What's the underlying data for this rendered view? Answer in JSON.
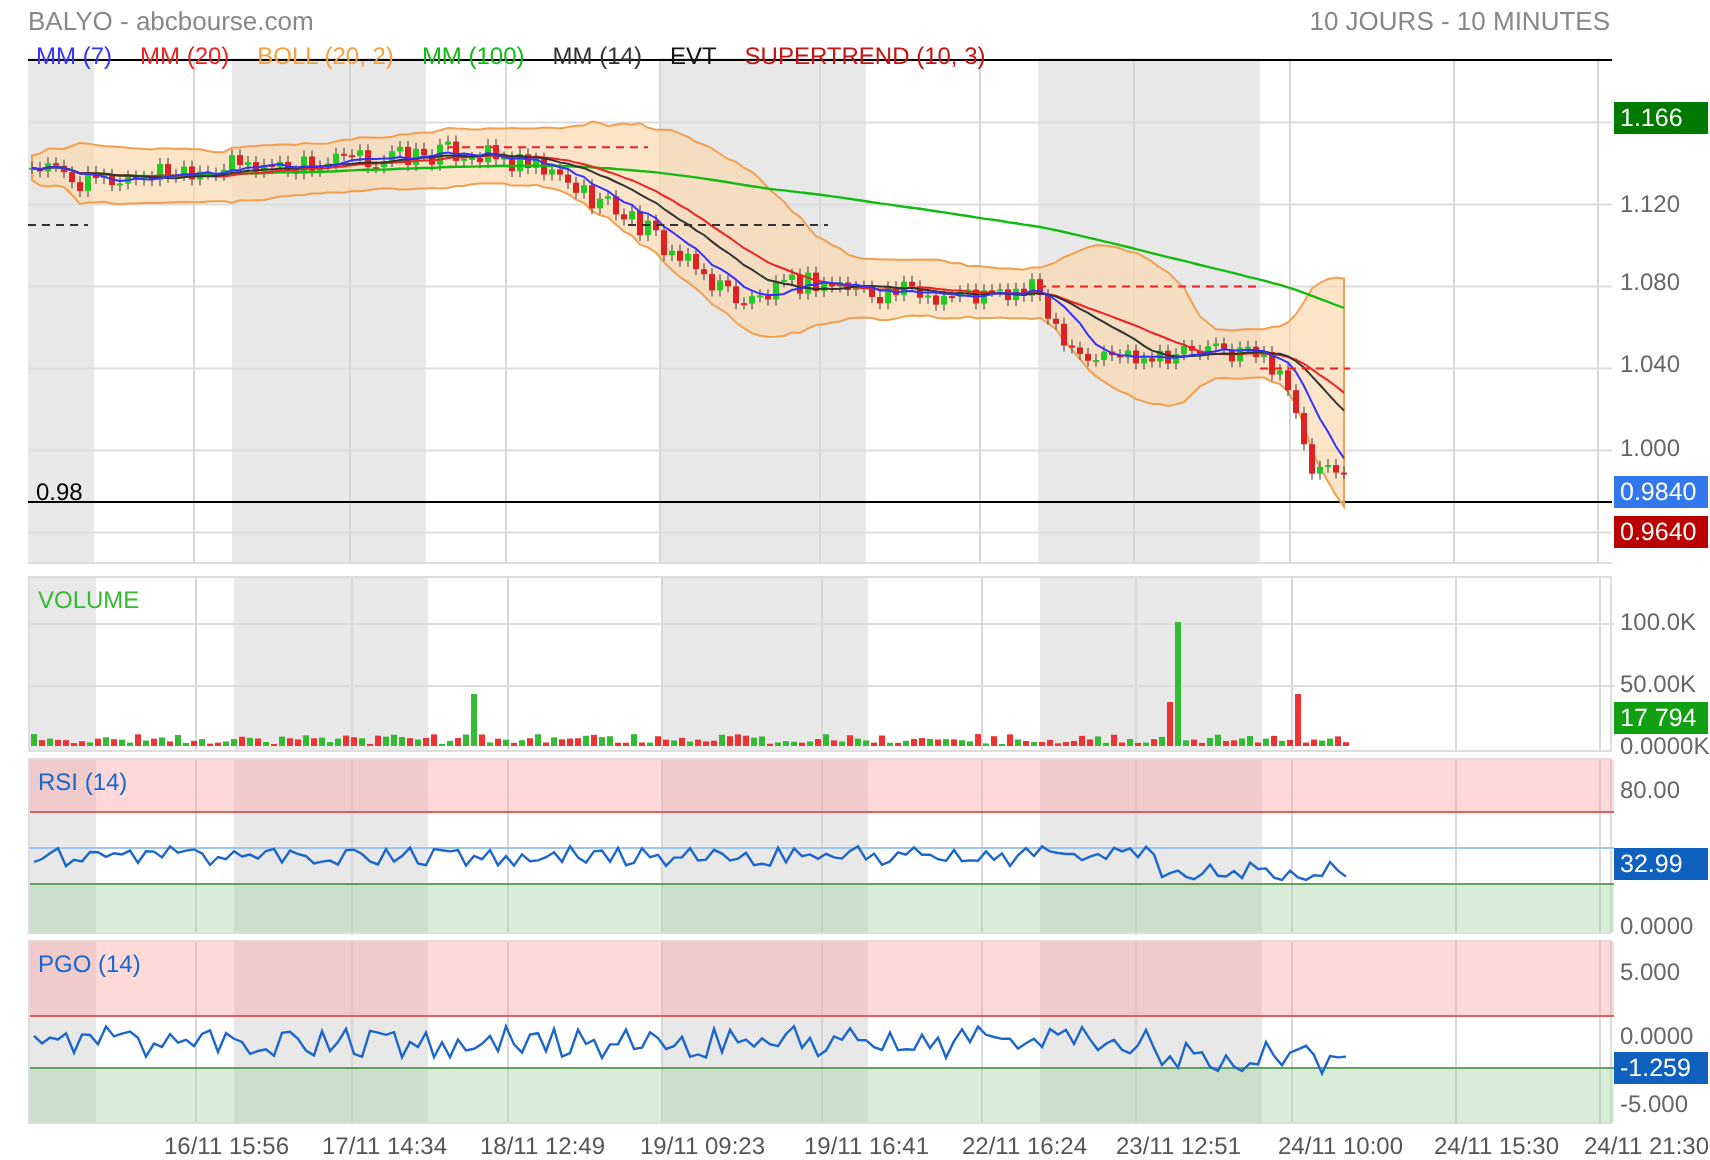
{
  "header": {
    "title": "BALYO - abcbourse.com",
    "period": "10 JOURS - 10 MINUTES"
  },
  "price_panel": {
    "legend": [
      {
        "label": "MM (7)",
        "color": "#3333ff"
      },
      {
        "label": "MM (20)",
        "color": "#ee2222"
      },
      {
        "label": "BOLL (20, 2)",
        "color": "#f5a040"
      },
      {
        "label": "MM (100)",
        "color": "#11bb11"
      },
      {
        "label": "MM (14)",
        "color": "#333333"
      },
      {
        "label": "EVT",
        "color": "#111111"
      },
      {
        "label": "SUPERTREND (10, 3)",
        "color": "#cc1111"
      }
    ],
    "line_label": "0.98",
    "ticks": [
      "1.120",
      "1.080",
      "1.040",
      "1.000"
    ],
    "badges": [
      {
        "text": "1.166",
        "color": "#007a00"
      },
      {
        "text": "0.9840",
        "color": "#3377ee"
      },
      {
        "text": "0.9640",
        "color": "#bb0000"
      }
    ]
  },
  "volume_panel": {
    "title": "VOLUME",
    "ticks": [
      "100.0K",
      "50.00K",
      "0.0000K"
    ],
    "badge": {
      "text": "17 794",
      "color": "#11a011"
    }
  },
  "rsi_panel": {
    "title": "RSI (14)",
    "ticks": [
      "80.00",
      "0.0000"
    ],
    "badge": {
      "text": "32.99",
      "color": "#1060c0"
    }
  },
  "pgo_panel": {
    "title": "PGO (14)",
    "ticks": [
      "5.000",
      "0.0000",
      "-5.000"
    ],
    "badge": {
      "text": "-1.259",
      "color": "#1060c0"
    }
  },
  "x_axis": [
    "16/11 15:56",
    "17/11 14:34",
    "18/11 12:49",
    "19/11 09:23",
    "19/11 16:41",
    "22/11 16:24",
    "23/11 12:51",
    "24/11 10:00",
    "24/11 15:30",
    "24/11 21:30"
  ]
}
